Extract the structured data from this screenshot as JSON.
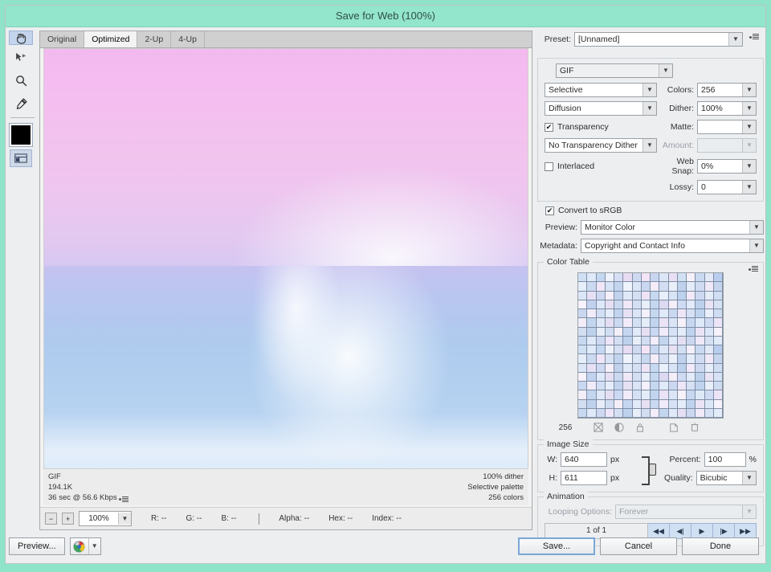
{
  "window": {
    "title": "Save for Web (100%)"
  },
  "tools": [
    {
      "name": "hand-tool",
      "glyph": "✋",
      "selected": true
    },
    {
      "name": "slice-select-tool",
      "glyph": "➤",
      "selected": false
    },
    {
      "name": "zoom-tool",
      "glyph": "🔍",
      "selected": false
    },
    {
      "name": "eyedropper-tool",
      "glyph": "✒",
      "selected": false
    }
  ],
  "eyedropper_color": "#000000",
  "toggle_slices_label": "▤",
  "preview": {
    "tabs": [
      {
        "label": "Original",
        "active": false
      },
      {
        "label": "Optimized",
        "active": true
      },
      {
        "label": "2-Up",
        "active": false
      },
      {
        "label": "4-Up",
        "active": false
      }
    ],
    "info_left": [
      "GIF",
      "194.1K",
      "36 sec @ 56.6 Kbps"
    ],
    "info_right": [
      "100% dither",
      "Selective palette",
      "256 colors"
    ]
  },
  "status": {
    "zoom": "100%",
    "readouts": [
      {
        "label": "R:",
        "value": "--"
      },
      {
        "label": "G:",
        "value": "--"
      },
      {
        "label": "B:",
        "value": "--"
      }
    ],
    "readouts2": [
      {
        "label": "Alpha:",
        "value": "--"
      },
      {
        "label": "Hex:",
        "value": "--"
      },
      {
        "label": "Index:",
        "value": "--"
      }
    ]
  },
  "settings": {
    "preset_label": "Preset:",
    "preset_value": "[Unnamed]",
    "file_format": "GIF",
    "reduction_algorithm": "Selective",
    "dither_algorithm": "Diffusion",
    "colors_label": "Colors:",
    "colors_value": "256",
    "dither_label": "Dither:",
    "dither_value": "100%",
    "transparency_label": "Transparency",
    "transparency_checked": true,
    "matte_label": "Matte:",
    "matte_value": "",
    "transparency_dither": "No Transparency Dither",
    "amount_label": "Amount:",
    "amount_value": "",
    "interlaced_label": "Interlaced",
    "interlaced_checked": false,
    "web_snap_label": "Web Snap:",
    "web_snap_value": "0%",
    "lossy_label": "Lossy:",
    "lossy_value": "0",
    "convert_srgb_label": "Convert to sRGB",
    "convert_srgb_checked": true,
    "preview_label": "Preview:",
    "preview_value": "Monitor Color",
    "metadata_label": "Metadata:",
    "metadata_value": "Copyright and Contact Info"
  },
  "color_table": {
    "title": "Color Table",
    "count": "256",
    "swatches": [
      "#cfe0f5",
      "#dfe9f8",
      "#c4d8f2",
      "#eef2fb",
      "#d6dff4",
      "#e8dcf2",
      "#cfd9f0",
      "#f3e4f6",
      "#c8d6ef",
      "#dde6f6",
      "#eae0f4",
      "#d2e0f4",
      "#f6f0fa",
      "#c9d9f1",
      "#e2e9f7",
      "#b9cdee",
      "#e6eefa",
      "#cbd9f1",
      "#f0e6f7",
      "#d8e3f5",
      "#c3d4ee",
      "#eff4fc",
      "#dbe6f7",
      "#c9d7f0",
      "#f4ecf8",
      "#d3def3",
      "#e9f0fa",
      "#bfd1ec",
      "#e4ecf9",
      "#d0dcf2",
      "#f1e8f8",
      "#c6d5ee",
      "#dbe7f7",
      "#e7e0f4",
      "#cdd9f0",
      "#f5eff9",
      "#c2d2ec",
      "#e0e9f8",
      "#d5e0f3",
      "#eee4f6",
      "#c7d8f1",
      "#e9f0fb",
      "#d9e4f6",
      "#bdd0ed",
      "#f2eaf8",
      "#ccd9f1",
      "#e5edf9",
      "#d1ddf3",
      "#f7f2fb",
      "#c0d2ee",
      "#dee8f8",
      "#e6dff3",
      "#cad8f0",
      "#f0e7f7",
      "#d4dff4",
      "#e8eff9",
      "#c5d6ef",
      "#ddd9f1",
      "#f4eef9",
      "#cedbf2",
      "#e2ebf8",
      "#bcd0ec",
      "#eae2f5",
      "#d7e2f4",
      "#c9d8f0",
      "#f1ecf9",
      "#d2def3",
      "#e4edf9",
      "#c1d3ed",
      "#e7e1f4",
      "#dbe5f6",
      "#f5f0fa",
      "#c6d7f0",
      "#e0eaf8",
      "#ccd8f0",
      "#eee6f7",
      "#d6e1f4",
      "#bfd2ee",
      "#e9eff9",
      "#d0dcf2",
      "#f3edf8",
      "#c3d5ef",
      "#dfe8f7",
      "#e5def2",
      "#cbd9f1",
      "#f2ebf9",
      "#d5e0f3",
      "#e3ecf8",
      "#c2d4ee",
      "#eae3f5",
      "#dae5f6",
      "#f6f1fa",
      "#c8d7f0",
      "#dee9f8",
      "#cfdbf2",
      "#edE5f7",
      "#d3def3",
      "#bed1ed",
      "#e8eef9",
      "#d1ddf2",
      "#f4eef9",
      "#c5d6f0",
      "#e1eaf8",
      "#e7e0f3",
      "#cad8f1",
      "#f1eaf8",
      "#d7e2f5",
      "#e4edf9",
      "#c0d3ee",
      "#ebe4f6",
      "#dbe6f7",
      "#f7f2fb",
      "#c7d8f1",
      "#dfe9f7",
      "#ced9f1",
      "#eee6f8",
      "#d4dff3",
      "#bdd0ec",
      "#e9eff9",
      "#d2ddf2",
      "#f3edf9",
      "#c4d5ef",
      "#e0e9f8",
      "#e6dff3",
      "#cbd8f0",
      "#f0e9f8",
      "#d6e1f4",
      "#e2ecf8"
    ],
    "footer_icons": [
      "snap-to-web-icon",
      "transparency-icon",
      "lock-icon",
      "new-color-icon",
      "delete-color-icon"
    ]
  },
  "image_size": {
    "title": "Image Size",
    "w_label": "W:",
    "w_value": "640",
    "w_unit": "px",
    "h_label": "H:",
    "h_value": "611",
    "h_unit": "px",
    "percent_label": "Percent:",
    "percent_value": "100",
    "percent_unit": "%",
    "quality_label": "Quality:",
    "quality_value": "Bicubic"
  },
  "animation": {
    "title": "Animation",
    "looping_label": "Looping Options:",
    "looping_value": "Forever",
    "frame_counter": "1 of 1",
    "transport": [
      "first-frame",
      "previous-frame",
      "play",
      "next-frame",
      "last-frame"
    ]
  },
  "footer": {
    "preview_label": "Preview...",
    "browser_icon": "browser-icon",
    "save_label": "Save...",
    "cancel_label": "Cancel",
    "done_label": "Done"
  }
}
